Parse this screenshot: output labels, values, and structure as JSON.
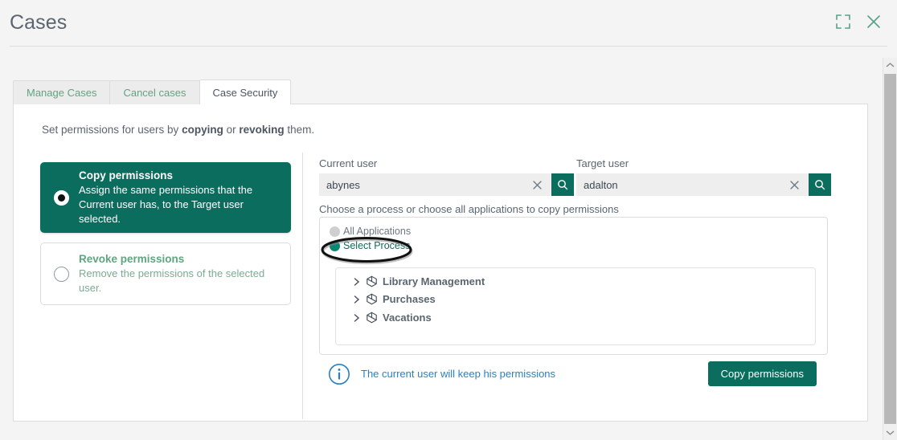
{
  "header": {
    "title": "Cases",
    "expand_icon": "expand-icon",
    "close_icon": "close-icon"
  },
  "tabs": [
    {
      "label": "Manage Cases",
      "active": false
    },
    {
      "label": "Cancel cases",
      "active": false
    },
    {
      "label": "Case Security",
      "active": true
    }
  ],
  "content": {
    "intro_prefix": "Set permissions for users by ",
    "intro_bold1": "copying",
    "intro_middle": " or ",
    "intro_bold2": "revoking",
    "intro_suffix": " them."
  },
  "options": [
    {
      "title": "Copy permissions",
      "description": "Assign the same permissions that the Current user has, to the Target user selected.",
      "selected": true
    },
    {
      "title": "Revoke permissions",
      "description": "Remove the permissions of the selected user.",
      "selected": false
    }
  ],
  "fields": {
    "current_user_label": "Current user",
    "current_user_value": "abynes",
    "current_user_placeholder": "",
    "target_user_label": "Target user",
    "target_user_value": "adalton",
    "target_user_placeholder": "",
    "clear_icon": "close-icon",
    "search_icon": "search-icon"
  },
  "process": {
    "choose_label": "Choose a process or choose all applications to copy permissions",
    "scope_options": [
      {
        "label": "All Applications",
        "selected": false
      },
      {
        "label": "Select Process",
        "selected": true
      }
    ],
    "tree": [
      {
        "label": "Library Management",
        "expanded": false
      },
      {
        "label": "Purchases",
        "expanded": false
      },
      {
        "label": "Vacations",
        "expanded": false
      }
    ]
  },
  "footer": {
    "info_icon": "info-icon",
    "info_text": "The current user will keep his permissions",
    "action_label": "Copy permissions"
  },
  "scrollbar": {
    "up_icon": "chevron-up-icon",
    "down_icon": "chevron-down-icon"
  },
  "colors": {
    "accent_teal": "#0a6d5e",
    "tab_green": "#5fa57f",
    "info_blue": "#2a7fc4",
    "text_gray": "#5a6570",
    "page_bg": "#f4f4f4"
  }
}
